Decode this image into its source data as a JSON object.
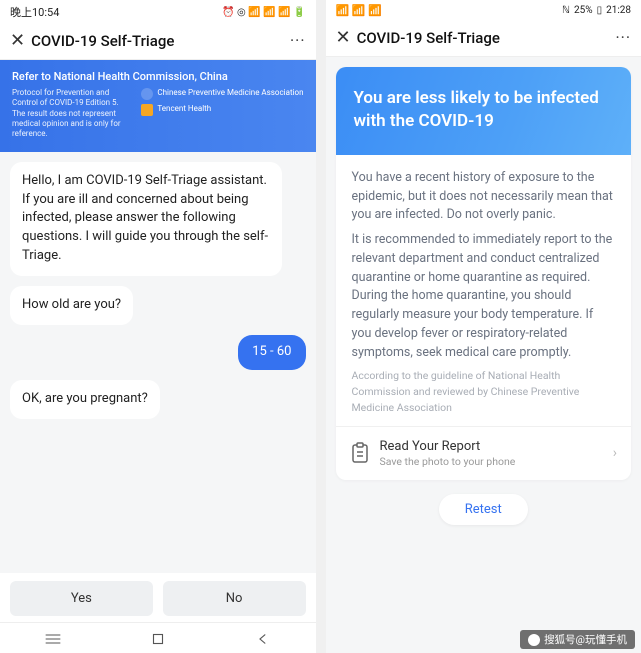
{
  "left": {
    "status": {
      "time": "晚上10:54",
      "icons": "⏰ ◎ 📶 📶 📶 🔋"
    },
    "header": {
      "title": "COVID-19 Self-Triage"
    },
    "banner": {
      "title": "Refer to National Health Commission, China",
      "subtitle": "Protocol for Prevention and Control of COVID-19 Edition 5. The result does not represent medical opinion and is only for reference.",
      "badge1": "Chinese Preventive Medicine Association",
      "badge2": "Tencent Health"
    },
    "messages": {
      "intro": "Hello, I am COVID-19 Self-Triage assistant. If you are ill and concerned about being infected, please answer the following questions. I will guide you through the self-Triage.",
      "q1": "How old are you?",
      "a1": "15 - 60",
      "q2": "OK, are you pregnant?"
    },
    "buttons": {
      "yes": "Yes",
      "no": "No"
    }
  },
  "right": {
    "status": {
      "left_icons": "📶 📶 📶",
      "battery": "25%",
      "time": "21:28"
    },
    "header": {
      "title": "COVID-19 Self-Triage"
    },
    "result": {
      "headline": "You are less likely to be infected with the COVID-19",
      "p1": "You have a recent history of exposure to the epidemic, but it does not necessarily mean that you are infected. Do not overly panic.",
      "p2": "It is recommended to immediately report to the relevant department and conduct centralized quarantine or home quarantine as required. During the home quarantine, you should regularly measure your body temperature. If you develop fever or respiratory-related symptoms, seek medical care promptly.",
      "footnote": "According to the guideline of National Health Commission and reviewed by Chinese Preventive Medicine Association"
    },
    "report": {
      "title": "Read Your Report",
      "sub": "Save the photo to your phone"
    },
    "retest": "Retest"
  },
  "watermark": "搜狐号@玩懂手机"
}
